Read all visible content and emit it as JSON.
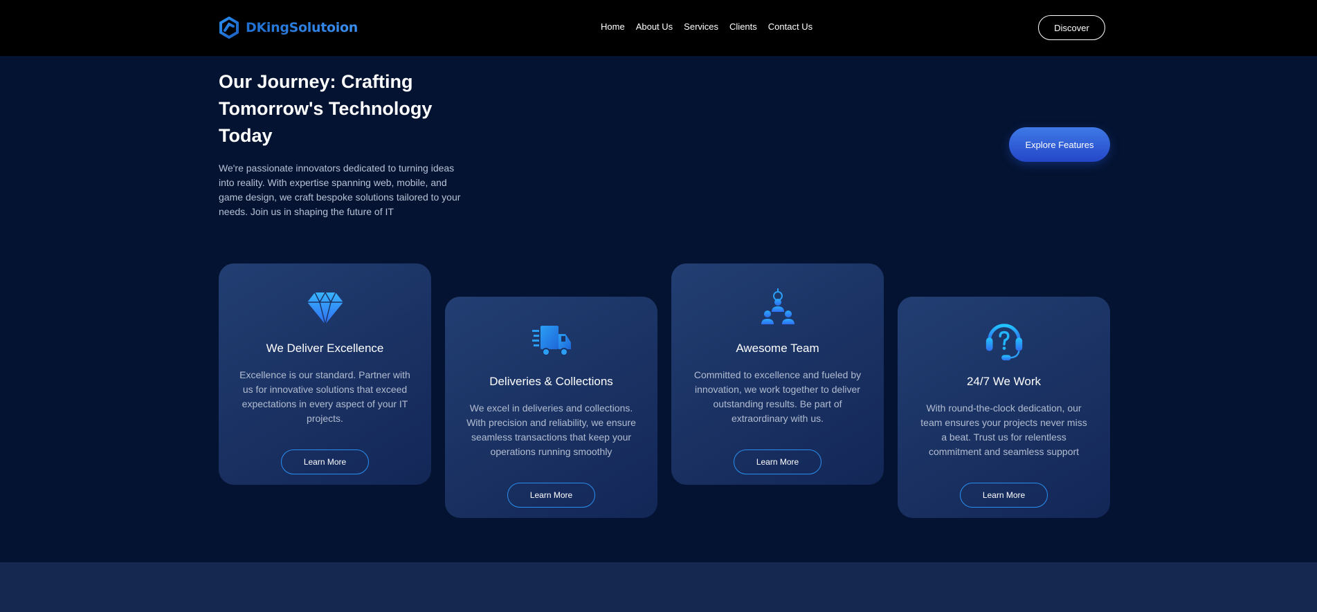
{
  "header": {
    "logo_text": "DKingSolutoion",
    "nav": [
      "Home",
      "About Us",
      "Services",
      "Clients",
      "Contact Us"
    ],
    "discover_label": "Discover"
  },
  "hero": {
    "title": "Our Journey: Crafting Tomorrow's Technology Today",
    "description": "We're passionate innovators dedicated to turning ideas into reality. With expertise spanning web, mobile, and game design, we craft bespoke solutions tailored to your needs. Join us in shaping the future of IT",
    "explore_label": "Explore Features"
  },
  "cards": [
    {
      "icon": "diamond-icon",
      "title": "We Deliver Excellence",
      "text": "Excellence is our standard. Partner with us for innovative solutions that exceed expectations in every aspect of your IT projects.",
      "button": "Learn More"
    },
    {
      "icon": "truck-icon",
      "title": "Deliveries & Collections",
      "text": "We excel in deliveries and collections. With precision and reliability, we ensure seamless transactions that keep your operations running smoothly",
      "button": "Learn More"
    },
    {
      "icon": "team-icon",
      "title": "Awesome Team",
      "text": "Committed to excellence and fueled by innovation, we work together to deliver outstanding results. Be part of extraordinary with us.",
      "button": "Learn More"
    },
    {
      "icon": "headset-support-icon",
      "title": "24/7 We Work",
      "text": "With round-the-clock dedication, our team ensures your projects never miss a beat. Trust us for relentless commitment and seamless support",
      "button": "Learn More"
    }
  ],
  "colors": {
    "page_background": "#041331",
    "header_background": "#000000",
    "card_background": "#1c3566",
    "accent_blue": "#2a8ff0",
    "explore_gradient_top": "#3f7ae6",
    "explore_gradient_bottom": "#2446c8",
    "bottom_band": "#15284f"
  }
}
